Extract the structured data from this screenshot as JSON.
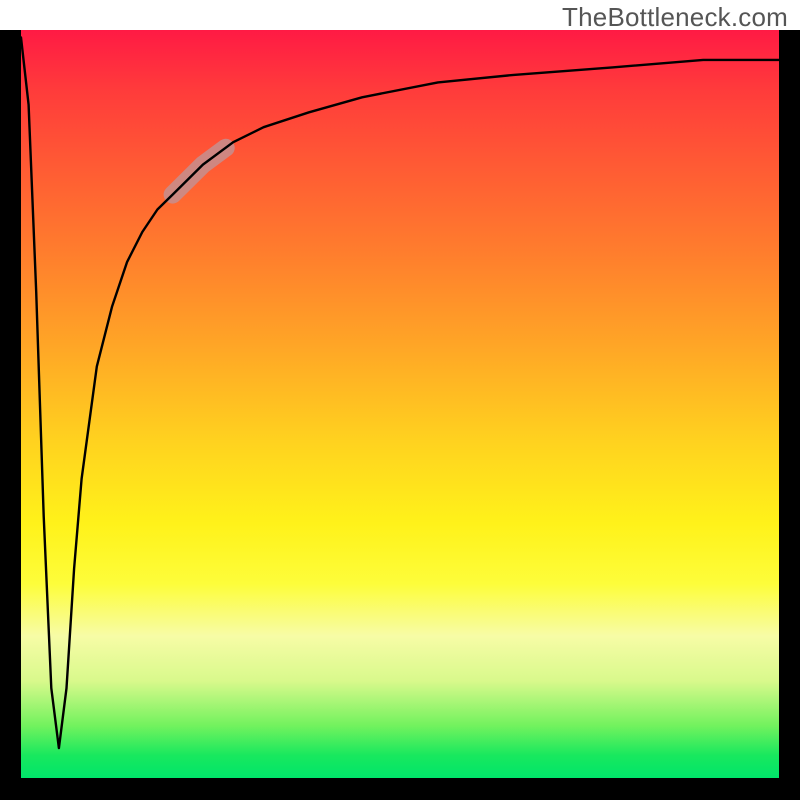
{
  "watermark": "TheBottleneck.com",
  "chart_data": {
    "type": "line",
    "title": "",
    "xlabel": "",
    "ylabel": "",
    "xlim": [
      0,
      100
    ],
    "ylim": [
      0,
      100
    ],
    "grid": false,
    "legend": false,
    "note": "Values are estimated from the rendered curve. y≈100 is the top edge, y≈0 the bottom edge. The curve plunges from near the top to a narrow minimum near x≈5, then rises asymptotically toward the top.",
    "series": [
      {
        "name": "bottleneck-curve",
        "x": [
          0,
          1,
          2,
          3,
          4,
          5,
          6,
          7,
          8,
          10,
          12,
          14,
          16,
          18,
          20,
          24,
          28,
          32,
          38,
          45,
          55,
          65,
          78,
          90,
          100
        ],
        "y": [
          99,
          90,
          65,
          35,
          12,
          4,
          12,
          28,
          40,
          55,
          63,
          69,
          73,
          76,
          78,
          82,
          85,
          87,
          89,
          91,
          93,
          94,
          95,
          96,
          96
        ]
      }
    ],
    "highlight_segment": {
      "description": "Pale pinkish overlay on the rising branch",
      "x_range": [
        20,
        27
      ],
      "y_range": [
        78,
        85
      ]
    },
    "background_gradient": {
      "orientation": "vertical",
      "stops": [
        {
          "pos": 0.0,
          "color": "#ff1a44"
        },
        {
          "pos": 0.3,
          "color": "#ff7e2d"
        },
        {
          "pos": 0.55,
          "color": "#ffd21f"
        },
        {
          "pos": 0.74,
          "color": "#fdfd3a"
        },
        {
          "pos": 0.93,
          "color": "#72f25e"
        },
        {
          "pos": 1.0,
          "color": "#00e56a"
        }
      ]
    }
  }
}
